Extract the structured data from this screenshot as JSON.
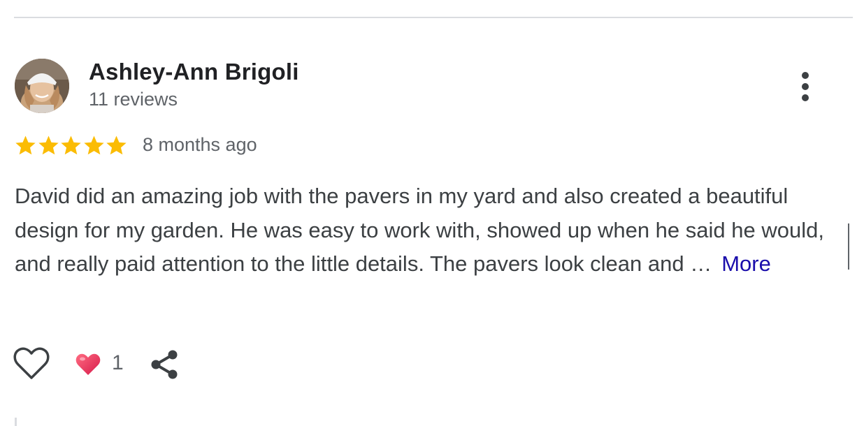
{
  "review": {
    "reviewer_name": "Ashley-Ann Brigoli",
    "review_count": "11 reviews",
    "rating": 5,
    "rating_max": 5,
    "date": "8 months ago",
    "text": "David did an amazing job with the pavers in my yard and also created a beautiful design for my garden. He was easy to work with, showed up when he said he would, and really paid attention to the little details. The pavers look clean and …",
    "more_label": "More"
  },
  "actions": {
    "reaction_count": "1"
  },
  "colors": {
    "star": "#fbbc04",
    "link": "#1a0dab",
    "text": "#3c4043",
    "muted": "#5f6368",
    "heart": "#e8305a"
  },
  "icons": {
    "menu": "more-vert-icon",
    "like": "heart-outline-icon",
    "reaction": "heart-filled-icon",
    "share": "share-icon",
    "star": "star-icon"
  }
}
